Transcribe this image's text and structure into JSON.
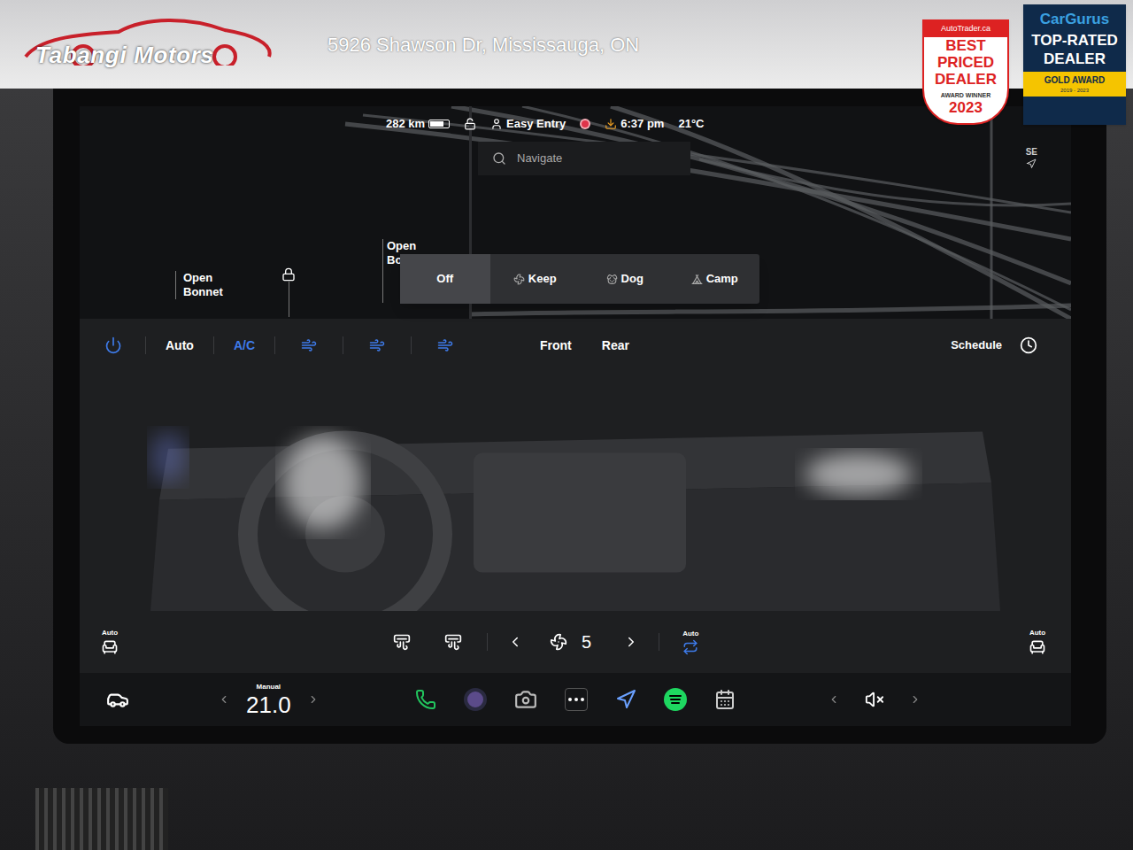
{
  "dealer": {
    "name": "Tabangi Motors",
    "address": "5926 Shawson Dr, Mississauga, ON"
  },
  "autotrader_badge": {
    "brand": "AutoTrader.ca",
    "lines": [
      "BEST",
      "PRICED",
      "DEALER"
    ],
    "sub": "AWARD WINNER",
    "year": "2023"
  },
  "cargurus_badge": {
    "brand": "CarGurus",
    "lines": [
      "TOP-RATED",
      "DEALER"
    ],
    "award": "GOLD AWARD",
    "years": "2019 - 2023"
  },
  "status_bar": {
    "range": "282 km",
    "battery_level": 0.75,
    "profile": "Easy Entry",
    "time": "6:37 pm",
    "temperature": "21°C"
  },
  "search": {
    "placeholder": "Navigate"
  },
  "compass": {
    "heading": "SE"
  },
  "map_labels": [
    {
      "line1": "Open",
      "line2": "Bonnet"
    },
    {
      "line1": "Open",
      "line2": "Bo"
    }
  ],
  "camp_modes": [
    {
      "label": "Off",
      "selected": true
    },
    {
      "label": "Keep",
      "selected": false
    },
    {
      "label": "Dog",
      "selected": false
    },
    {
      "label": "Camp",
      "selected": false
    }
  ],
  "climate": {
    "power_on": true,
    "modes": [
      {
        "label": "Auto",
        "active": false
      },
      {
        "label": "A/C",
        "active": true
      }
    ],
    "zones": [
      "Front",
      "Rear"
    ],
    "schedule": "Schedule",
    "fan_speed": "5",
    "seat_left_mode": "Auto",
    "recirc_mode": "Auto",
    "seat_right_mode": "Auto"
  },
  "taskbar": {
    "temp_mode": "Manual",
    "temperature": "21.0",
    "muted": true
  }
}
